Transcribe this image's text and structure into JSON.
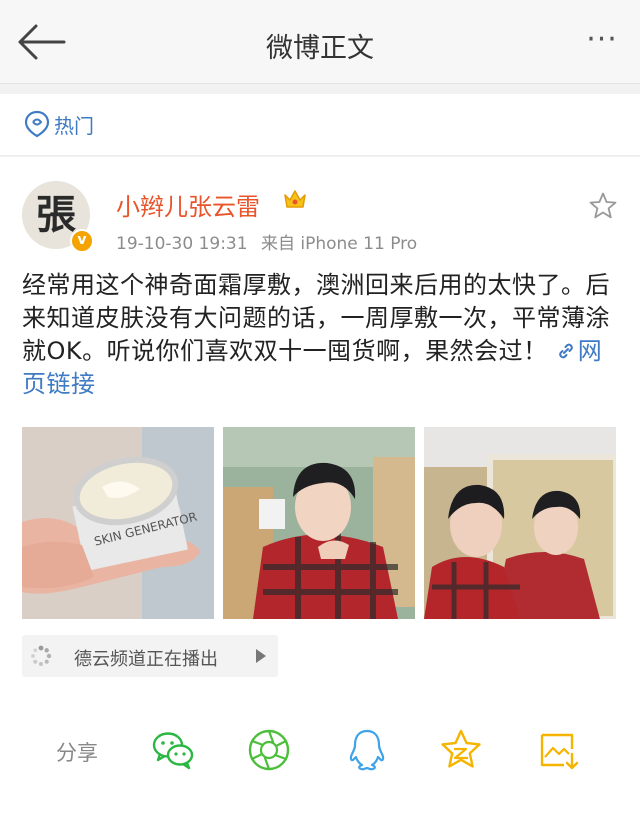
{
  "header": {
    "title": "微博正文",
    "more_label": "···"
  },
  "hot": {
    "label": "热门"
  },
  "post": {
    "author": "小辫儿张云雷",
    "avatar_char": "張",
    "badge": "v",
    "timestamp": "19-10-30 19:31",
    "source": "来自 iPhone 11 Pro",
    "text": "经常用这个神奇面霜厚敷，澳洲回来后用的太快了。后来知道皮肤没有大问题的话，一周厚敷一次，平常薄涂就OK。听说你们喜欢双十一囤货啊，果然会过！",
    "link_label": "网页链接",
    "jar_label": "SKIN GENERATOR"
  },
  "channel": {
    "label": "德云频道正在播出"
  },
  "share": {
    "label": "分享"
  },
  "colors": {
    "accent_orange": "#e9542a",
    "link_blue": "#3f7bc4",
    "wechat_green": "#2bb741",
    "moments_green": "#4cbf3a",
    "qq_blue": "#3ea3e8",
    "qzone_yellow": "#f4b400"
  }
}
